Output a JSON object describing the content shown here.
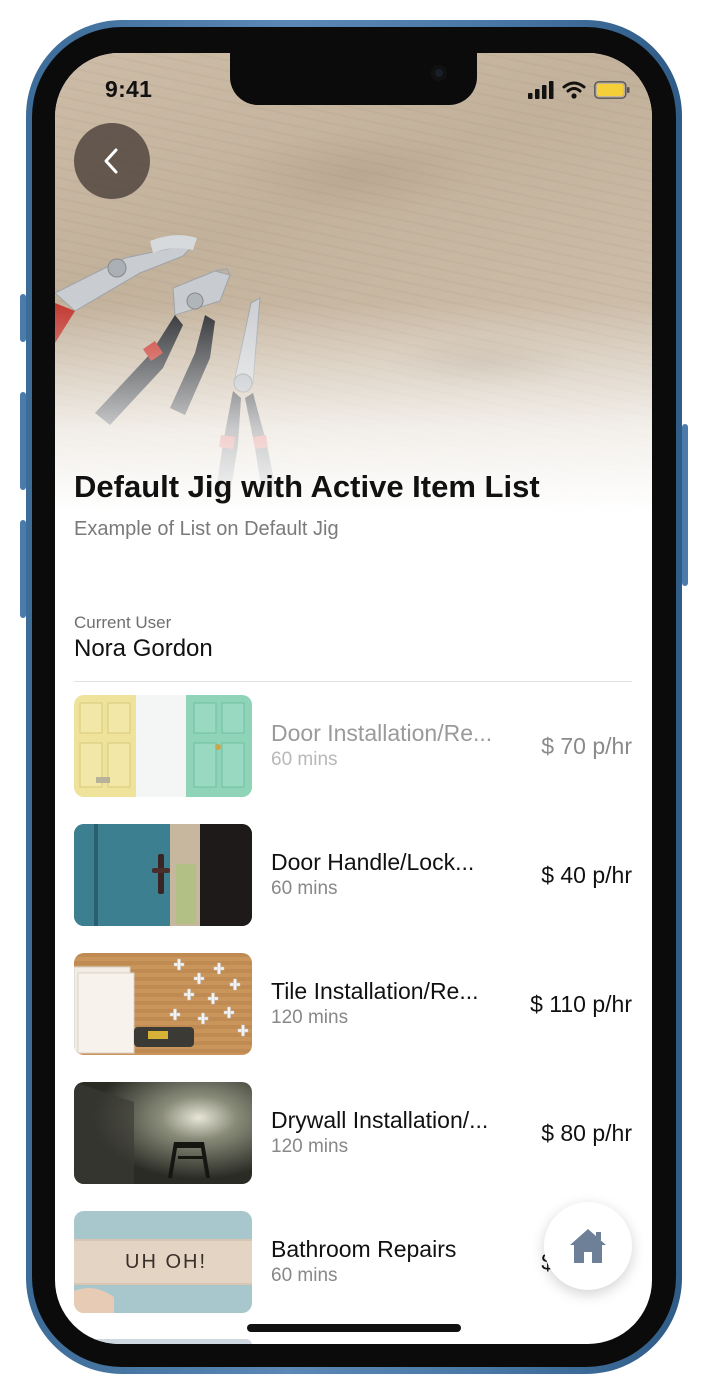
{
  "status_bar": {
    "time": "9:41"
  },
  "header": {
    "title": "Default Jig with Active Item List",
    "subtitle": "Example of List on Default Jig"
  },
  "user": {
    "label": "Current User",
    "name": "Nora Gordon"
  },
  "items": [
    {
      "name": "Door Installation/Re...",
      "duration": "60 mins",
      "price": "$ 70 p/hr",
      "dimmed": true
    },
    {
      "name": "Door Handle/Lock...",
      "duration": "60 mins",
      "price": "$ 40 p/hr",
      "dimmed": false
    },
    {
      "name": "Tile Installation/Re...",
      "duration": "120 mins",
      "price": "$ 110 p/hr",
      "dimmed": false
    },
    {
      "name": "Drywall Installation/...",
      "duration": "120 mins",
      "price": "$ 80 p/hr",
      "dimmed": false
    },
    {
      "name": "Bathroom Repairs",
      "duration": "60 mins",
      "price": "$",
      "dimmed": false
    }
  ],
  "thumb_texts": {
    "bathroom_sign": "UH OH!"
  },
  "icons": {
    "back": "chevron-left-icon",
    "home": "home-icon",
    "signal": "signal-icon",
    "wifi": "wifi-icon",
    "battery": "battery-icon"
  },
  "colors": {
    "battery": "#f5cf3a",
    "home_icon": "#6e7f98"
  }
}
